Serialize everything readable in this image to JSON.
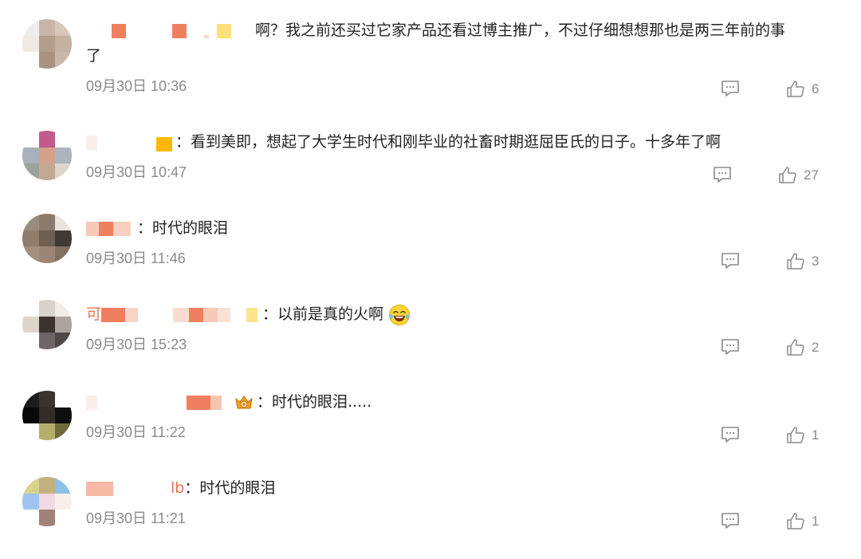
{
  "comments": [
    {
      "username": "",
      "text": "啊？我之前还买过它家产品还看过博主推广，不过仔细想想那也是两三年前的事了",
      "text_line1": "啊？我之前还买过它家产品还看过博主推广，不过仔细想想那也是两三年前的事",
      "text_line2": "了",
      "time": "09月30日 10:36",
      "likes": "6"
    },
    {
      "username": "",
      "text": "看到美即，想起了大学生时代和刚毕业的社畜时期逛屈臣氏的日子。十多年了啊",
      "time": "09月30日 10:47",
      "likes": "27"
    },
    {
      "username": "",
      "text": "时代的眼泪",
      "time": "09月30日 11:46",
      "likes": "3"
    },
    {
      "username": "可",
      "text": "以前是真的火啊",
      "emoji": "crying-laughing-emoji",
      "time": "09月30日 15:23",
      "likes": "2"
    },
    {
      "username": "",
      "text": "时代的眼泪.....",
      "badge": "crown-badge-icon",
      "time": "09月30日 11:22",
      "likes": "1"
    },
    {
      "username": "lb",
      "text": "时代的眼泪",
      "time": "09月30日 11:21",
      "likes": "1"
    }
  ],
  "separator": "：",
  "icons": {
    "reply": "comment-icon",
    "like": "thumbs-up-icon"
  },
  "colors": {
    "username": "#eb7350",
    "meta": "#8a8a8a",
    "text": "#222222"
  }
}
